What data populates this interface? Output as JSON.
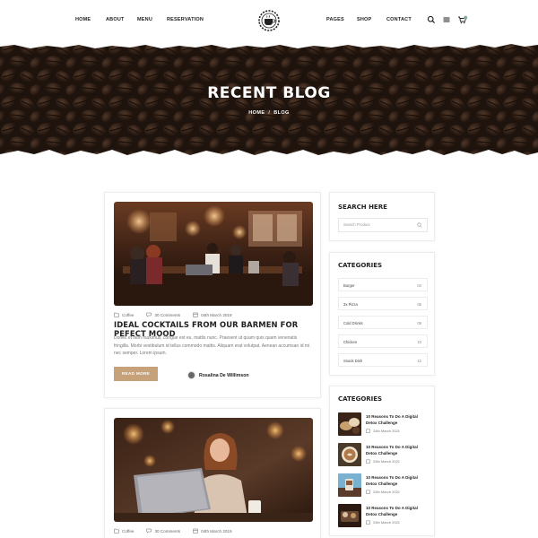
{
  "nav": {
    "left": [
      "HOME",
      "ABOUT",
      "MENU",
      "RESERVATION"
    ],
    "right": [
      "PAGES",
      "SHOP",
      "CONTACT"
    ],
    "logo_icon": "coffee-cup-logo",
    "icons": [
      "search-icon",
      "menu-icon",
      "cart-icon"
    ],
    "accent": "#c7a17a"
  },
  "hero": {
    "title": "RECENT BLOG",
    "crumb_home": "HOME",
    "crumb_sep": "/",
    "crumb_current": "BLOG"
  },
  "posts": [
    {
      "category": "Coffee",
      "comments": "30 Comments",
      "date": "04th March 2019",
      "title": "IDEAL COCKTAILS FROM OUR BARMEN FOR PEFECT MOOD",
      "excerpt": "Donec et nibh maximus, congue est eu, mattis nunc. Praesent ut quam quis quam venenatis fringilla. Morbi vestibulum id tellus commodo mattis. Aliquam erat volutpat. Aenean accumsan id mi nec semper. Lorem ipsum.",
      "button": "READ MORE",
      "author": "Rosalina De Willimson"
    },
    {
      "category": "Coffee",
      "comments": "30 Comments",
      "date": "04th March 2019"
    }
  ],
  "sidebar": {
    "search": {
      "title": "SEARCH HERE",
      "placeholder": "Search Product"
    },
    "categories": {
      "title": "CATEGORIES",
      "items": [
        {
          "name": "Burger",
          "count": "04"
        },
        {
          "name": "3x Pizza",
          "count": "06"
        },
        {
          "name": "Cold Drinks",
          "count": "08"
        },
        {
          "name": "Chicken",
          "count": "10"
        },
        {
          "name": "Snack Dish",
          "count": "12"
        }
      ]
    },
    "recent": {
      "title": "CATEGORIES",
      "items": [
        {
          "title": "10 Reasons To Do A Digital Detox Challenge",
          "date": "24th March 2021"
        },
        {
          "title": "10 Reasons To Do A Digital Detox Challenge",
          "date": "24th March 2021"
        },
        {
          "title": "10 Reasons To Do A Digital Detox Challenge",
          "date": "24th March 2021"
        },
        {
          "title": "10 Reasons To Do A Digital Detox Challenge",
          "date": "24th March 2021"
        }
      ]
    }
  }
}
